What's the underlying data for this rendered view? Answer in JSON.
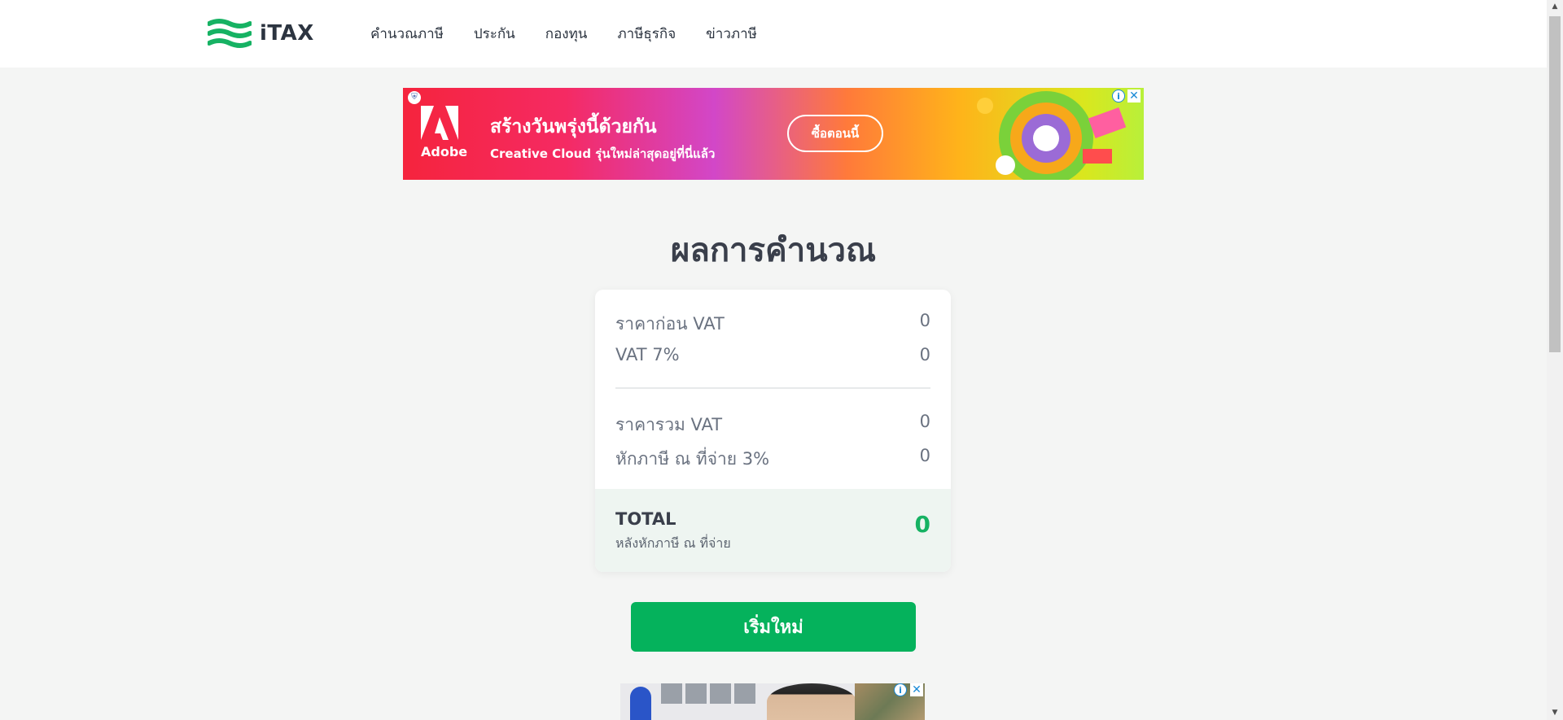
{
  "brand": {
    "name": "iTAX"
  },
  "nav": {
    "items": [
      {
        "label": "คำนวณภาษี"
      },
      {
        "label": "ประกัน"
      },
      {
        "label": "กองทุน"
      },
      {
        "label": "ภาษีธุรกิจ"
      },
      {
        "label": "ข่าวภาษี"
      }
    ]
  },
  "ad_top": {
    "brand": "Adobe",
    "title": "สร้างวันพรุ่งนี้ด้วยกัน",
    "subtitle": "Creative Cloud รุ่นใหม่ล่าสุดอยู่ที่นี่แล้ว",
    "cta": "ซื้อตอนนี้",
    "info_icon": "i",
    "close_icon": "✕"
  },
  "result": {
    "title": "ผลการคำนวณ",
    "rows": [
      {
        "label": "ราคาก่อน VAT",
        "value": "0"
      },
      {
        "label": "VAT 7%",
        "value": "0"
      },
      {
        "label": "ราคารวม VAT",
        "value": "0"
      },
      {
        "label": "หักภาษี ณ ที่จ่าย 3%",
        "value": "0"
      }
    ],
    "total": {
      "label": "TOTAL",
      "sublabel": "หลังหักภาษี ณ ที่จ่าย",
      "value": "0"
    }
  },
  "actions": {
    "reset_label": "เริ่มใหม่"
  },
  "ad_bottom": {
    "info_icon": "i",
    "close_icon": "✕"
  },
  "colors": {
    "accent": "#05b25c",
    "total_value": "#16b263",
    "background": "#f4f5f4",
    "text_dark": "#3a3f4b"
  }
}
